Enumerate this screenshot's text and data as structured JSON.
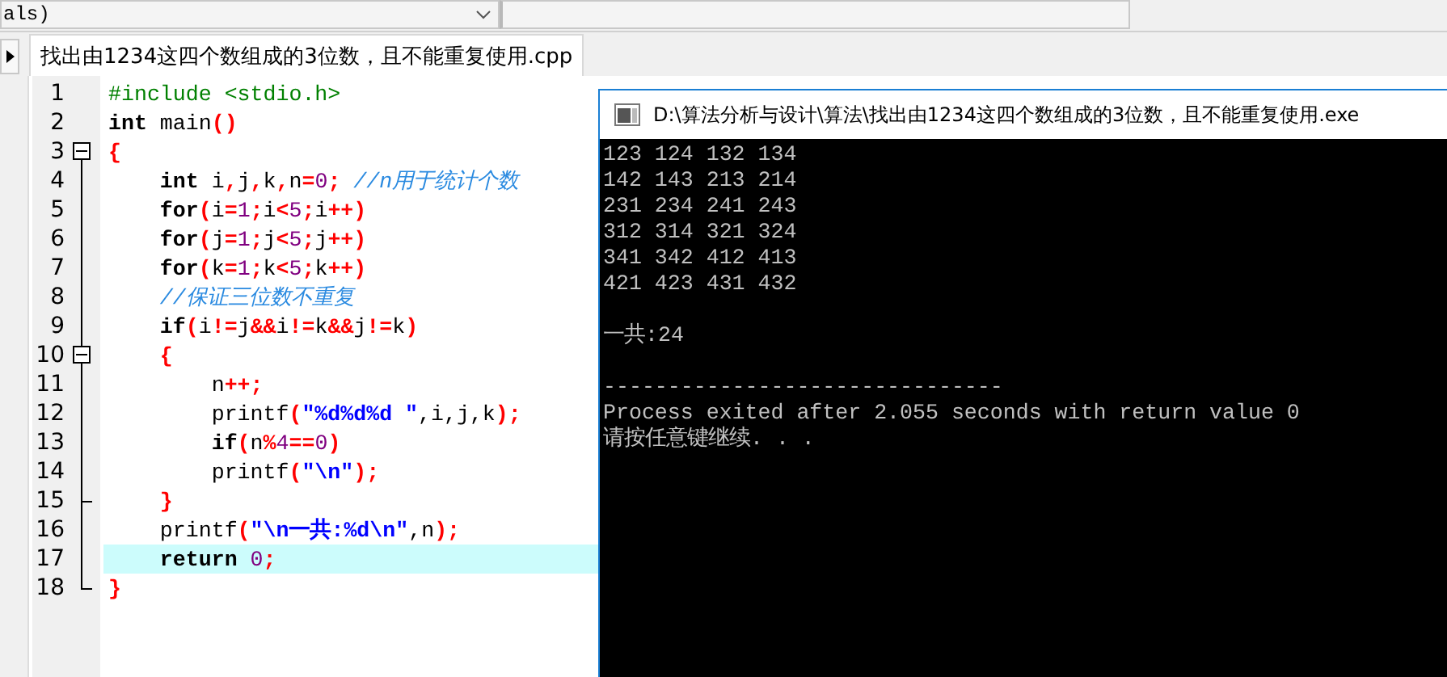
{
  "toolbar": {
    "combo_boxes": [
      {
        "value": "als)"
      }
    ]
  },
  "tabs": [
    {
      "label": "找出由1234这四个数组成的3位数，且不能重复使用.cpp",
      "selected": true
    }
  ],
  "editor": {
    "lines": [
      {
        "number": "1",
        "kind": "line",
        "tokens": [
          {
            "kind": "pp",
            "text": "#include <stdio.h>"
          }
        ]
      },
      {
        "number": "2",
        "kind": "line",
        "tokens": [
          {
            "kind": "kw",
            "text": "int"
          },
          {
            "kind": "plain",
            "text": " main"
          },
          {
            "kind": "sym",
            "text": "()"
          }
        ]
      },
      {
        "number": "3",
        "kind": "fold_start",
        "expanded": true,
        "tokens": [
          {
            "kind": "sym",
            "text": "{"
          }
        ]
      },
      {
        "number": "4",
        "kind": "line",
        "tokens": [
          {
            "kind": "kw",
            "text": "    int"
          },
          {
            "kind": "plain",
            "text": " i"
          },
          {
            "kind": "sym",
            "text": ","
          },
          {
            "kind": "plain",
            "text": "j"
          },
          {
            "kind": "sym",
            "text": ","
          },
          {
            "kind": "plain",
            "text": "k"
          },
          {
            "kind": "sym",
            "text": ","
          },
          {
            "kind": "plain",
            "text": "n"
          },
          {
            "kind": "sym",
            "text": "="
          },
          {
            "kind": "num",
            "text": "0"
          },
          {
            "kind": "sym",
            "text": ";"
          },
          {
            "kind": "cmt",
            "text": " //n用于统计个数"
          }
        ]
      },
      {
        "number": "5",
        "kind": "line",
        "tokens": [
          {
            "kind": "kw",
            "text": "    for"
          },
          {
            "kind": "sym",
            "text": "("
          },
          {
            "kind": "plain",
            "text": "i"
          },
          {
            "kind": "sym",
            "text": "="
          },
          {
            "kind": "num",
            "text": "1"
          },
          {
            "kind": "sym",
            "text": ";"
          },
          {
            "kind": "plain",
            "text": "i"
          },
          {
            "kind": "sym",
            "text": "<"
          },
          {
            "kind": "num",
            "text": "5"
          },
          {
            "kind": "sym",
            "text": ";"
          },
          {
            "kind": "plain",
            "text": "i"
          },
          {
            "kind": "sym",
            "text": "++)"
          }
        ]
      },
      {
        "number": "6",
        "kind": "line",
        "tokens": [
          {
            "kind": "kw",
            "text": "    for"
          },
          {
            "kind": "sym",
            "text": "("
          },
          {
            "kind": "plain",
            "text": "j"
          },
          {
            "kind": "sym",
            "text": "="
          },
          {
            "kind": "num",
            "text": "1"
          },
          {
            "kind": "sym",
            "text": ";"
          },
          {
            "kind": "plain",
            "text": "j"
          },
          {
            "kind": "sym",
            "text": "<"
          },
          {
            "kind": "num",
            "text": "5"
          },
          {
            "kind": "sym",
            "text": ";"
          },
          {
            "kind": "plain",
            "text": "j"
          },
          {
            "kind": "sym",
            "text": "++)"
          }
        ]
      },
      {
        "number": "7",
        "kind": "line",
        "tokens": [
          {
            "kind": "kw",
            "text": "    for"
          },
          {
            "kind": "sym",
            "text": "("
          },
          {
            "kind": "plain",
            "text": "k"
          },
          {
            "kind": "sym",
            "text": "="
          },
          {
            "kind": "num",
            "text": "1"
          },
          {
            "kind": "sym",
            "text": ";"
          },
          {
            "kind": "plain",
            "text": "k"
          },
          {
            "kind": "sym",
            "text": "<"
          },
          {
            "kind": "num",
            "text": "5"
          },
          {
            "kind": "sym",
            "text": ";"
          },
          {
            "kind": "plain",
            "text": "k"
          },
          {
            "kind": "sym",
            "text": "++)"
          }
        ]
      },
      {
        "number": "8",
        "kind": "line",
        "tokens": [
          {
            "kind": "cmt",
            "text": "    //保证三位数不重复"
          }
        ]
      },
      {
        "number": "9",
        "kind": "line",
        "tokens": [
          {
            "kind": "kw",
            "text": "    if"
          },
          {
            "kind": "sym",
            "text": "("
          },
          {
            "kind": "plain",
            "text": "i"
          },
          {
            "kind": "sym",
            "text": "!="
          },
          {
            "kind": "plain",
            "text": "j"
          },
          {
            "kind": "sym",
            "text": "&&"
          },
          {
            "kind": "plain",
            "text": "i"
          },
          {
            "kind": "sym",
            "text": "!="
          },
          {
            "kind": "plain",
            "text": "k"
          },
          {
            "kind": "sym",
            "text": "&&"
          },
          {
            "kind": "plain",
            "text": "j"
          },
          {
            "kind": "sym",
            "text": "!="
          },
          {
            "kind": "plain",
            "text": "k"
          },
          {
            "kind": "sym",
            "text": ")"
          }
        ]
      },
      {
        "number": "10",
        "kind": "fold_start",
        "expanded": true,
        "tokens": [
          {
            "kind": "sym",
            "text": "    {"
          }
        ]
      },
      {
        "number": "11",
        "kind": "line",
        "tokens": [
          {
            "kind": "plain",
            "text": "        n"
          },
          {
            "kind": "sym",
            "text": "++;"
          }
        ]
      },
      {
        "number": "12",
        "kind": "line",
        "tokens": [
          {
            "kind": "plain",
            "text": "        printf"
          },
          {
            "kind": "sym",
            "text": "("
          },
          {
            "kind": "str",
            "text": "\"%d%d%d \""
          },
          {
            "kind": "plain",
            "text": ",i,j,k"
          },
          {
            "kind": "sym",
            "text": ");"
          }
        ]
      },
      {
        "number": "13",
        "kind": "line",
        "tokens": [
          {
            "kind": "kw",
            "text": "        if"
          },
          {
            "kind": "sym",
            "text": "("
          },
          {
            "kind": "plain",
            "text": "n"
          },
          {
            "kind": "sym",
            "text": "%"
          },
          {
            "kind": "num",
            "text": "4"
          },
          {
            "kind": "sym",
            "text": "=="
          },
          {
            "kind": "num",
            "text": "0"
          },
          {
            "kind": "sym",
            "text": ")"
          }
        ]
      },
      {
        "number": "14",
        "kind": "line",
        "tokens": [
          {
            "kind": "plain",
            "text": "        printf"
          },
          {
            "kind": "sym",
            "text": "("
          },
          {
            "kind": "str",
            "text": "\"\\n\""
          },
          {
            "kind": "sym",
            "text": ");"
          }
        ]
      },
      {
        "number": "15",
        "kind": "fold_end",
        "tokens": [
          {
            "kind": "sym",
            "text": "    }"
          }
        ]
      },
      {
        "number": "16",
        "kind": "line",
        "tokens": [
          {
            "kind": "plain",
            "text": "    printf"
          },
          {
            "kind": "sym",
            "text": "("
          },
          {
            "kind": "str",
            "text": "\"\\n一共:%d\\n\""
          },
          {
            "kind": "plain",
            "text": ",n"
          },
          {
            "kind": "sym",
            "text": ");"
          }
        ]
      },
      {
        "number": "17",
        "kind": "line",
        "highlighted": true,
        "tokens": [
          {
            "kind": "kw",
            "text": "    return"
          },
          {
            "kind": "num",
            "text": " 0"
          },
          {
            "kind": "sym",
            "text": ";"
          }
        ]
      },
      {
        "number": "18",
        "kind": "fold_end",
        "tokens": [
          {
            "kind": "sym",
            "text": "}"
          }
        ]
      }
    ]
  },
  "console": {
    "title": "D:\\算法分析与设计\\算法\\找出由1234这四个数组成的3位数，且不能重复使用.exe",
    "blocks": [
      {
        "lines": [
          "123 124 132 134",
          "142 143 213 214",
          "231 234 241 243",
          "312 314 321 324",
          "341 342 412 413",
          "421 423 431 432"
        ]
      },
      {
        "lines": [
          "一共:24"
        ]
      },
      {
        "lines": [
          "-------------------------------",
          "Process exited after 2.055 seconds with return value 0",
          "请按任意键继续. . ."
        ]
      }
    ]
  }
}
